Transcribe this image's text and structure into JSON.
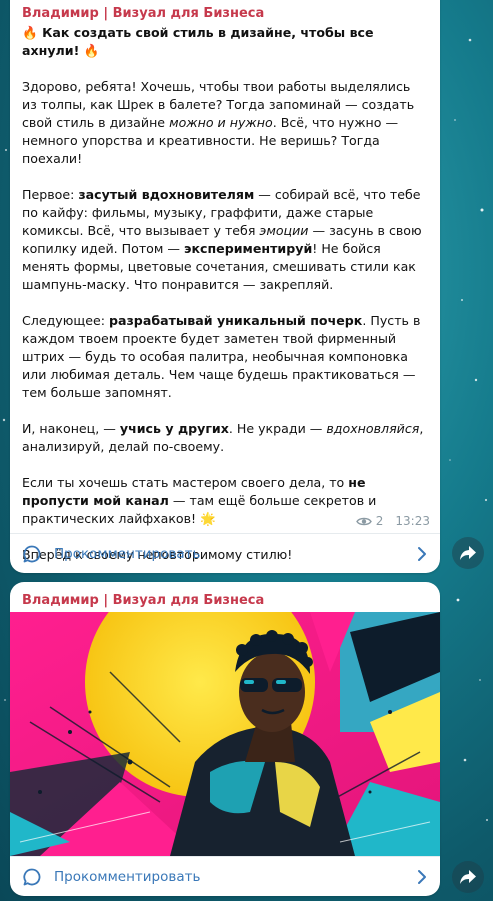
{
  "channel": {
    "author": "Владимир | Визуал для Бизнеса"
  },
  "post1": {
    "title": "Как создать свой стиль в дизайне, чтобы все ахнули!",
    "p1": {
      "a": "Здорово, ребята! Хочешь, чтобы твои работы выделялись из толпы, как Шрек в балете? Тогда запоминай — создать свой стиль в дизайне ",
      "b": "можно и нужно",
      "c": ". Всё, что нужно — немного упорства и креативности. Не веришь? Тогда поехали!"
    },
    "p2": {
      "a": "Первое: ",
      "b": "засутый вдохновителям",
      "c": " — собирай всё, что тебе по кайфу: фильмы, музыку, граффити, даже старые комиксы. Всё, что вызывает у тебя ",
      "d": "эмоции",
      "e": " — засунь в свою копилку идей. Потом — ",
      "f": "экспериментируй",
      "g": "! Не бойся менять формы, цветовые сочетания, смешивать стили как шампунь-маску. Что понравится — закрепляй."
    },
    "p3": {
      "a": "Следующее: ",
      "b": "разрабатывай уникальный почерк",
      "c": ". Пусть в каждом твоем проекте будет заметен твой фирменный штрих — будь то особая палитра, необычная компоновка или любимая деталь. Чем чаще будешь практиковаться — тем больше запомнят."
    },
    "p4": {
      "a": "И, наконец, — ",
      "b": "учись у других",
      "c": ". Не укради — ",
      "d": "вдохновляйся",
      "e": ", анализируй, делай по-своему."
    },
    "p5": {
      "a": "Если ты хочешь стать мастером своего дела, то ",
      "b": "не пропусти мой канал",
      "c": " — там ещё больше секретов и практических лайфхаков!"
    },
    "p6": "Вперёд к своему неповторимому стилю!",
    "views": "2",
    "time": "13:23",
    "comment_label": "Прокомментировать"
  },
  "post2": {
    "comment_label": "Прокомментировать"
  },
  "colors": {
    "author": "#c6394c",
    "link": "#3a78b8",
    "meta": "#8b9aa3",
    "wallpaper": "#157b8c"
  },
  "icons": {
    "title_emoji": "fire-icon",
    "p5_emoji": "sparkle-icon",
    "views": "eye-icon",
    "comment": "comment-bubble-icon",
    "chevron": "chevron-right-icon",
    "share": "share-arrow-icon"
  }
}
